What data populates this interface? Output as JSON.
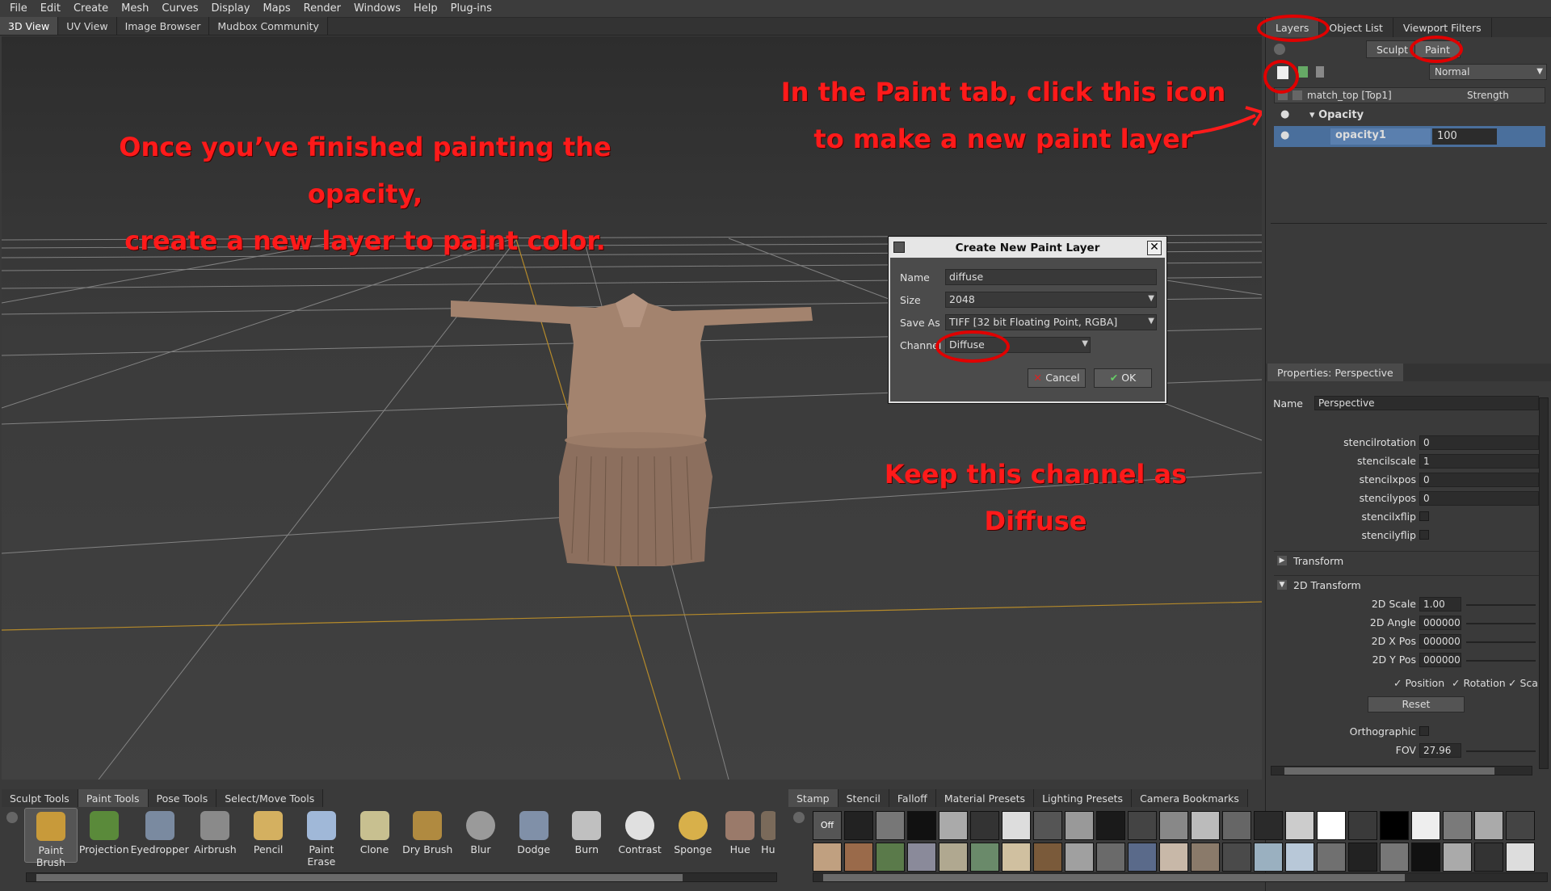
{
  "menu": [
    "File",
    "Edit",
    "Create",
    "Mesh",
    "Curves",
    "Display",
    "Maps",
    "Render",
    "Windows",
    "Help",
    "Plug-ins"
  ],
  "view_tabs": [
    "3D View",
    "UV View",
    "Image Browser",
    "Mudbox Community"
  ],
  "annotations": {
    "left": [
      "Once you’ve finished painting the opacity,",
      "create a new layer to paint color."
    ],
    "right": [
      "In the Paint tab, click this icon",
      "to make a new paint layer"
    ],
    "channel": "Keep this channel as Diffuse"
  },
  "dialog": {
    "title": "Create New Paint Layer",
    "name_label": "Name",
    "name_value": "diffuse",
    "size_label": "Size",
    "size_value": "2048",
    "saveas_label": "Save As",
    "saveas_value": "TIFF [32 bit Floating Point, RGBA]",
    "channel_label": "Channel",
    "channel_value": "Diffuse",
    "cancel": "Cancel",
    "ok": "OK"
  },
  "right_tabs": [
    "Layers",
    "Object List",
    "Viewport Filters"
  ],
  "layers": {
    "sculpt": "Sculpt",
    "paint": "Paint",
    "blend_mode": "Normal",
    "header_name": "match_top [Top1]",
    "header_strength": "Strength",
    "group": "Opacity",
    "layer_name": "opacity1",
    "layer_value": "100"
  },
  "properties": {
    "title": "Properties: Perspective",
    "name_label": "Name",
    "name_value": "Perspective",
    "rows": [
      {
        "label": "stencilrotation",
        "value": "0"
      },
      {
        "label": "stencilscale",
        "value": "1"
      },
      {
        "label": "stencilxpos",
        "value": "0"
      },
      {
        "label": "stencilypos",
        "value": "0"
      }
    ],
    "checks": [
      "stencilxflip",
      "stencilyflip"
    ],
    "transform": "Transform",
    "transform2d": "2D Transform",
    "t2d": [
      {
        "label": "2D Scale",
        "value": "1.00"
      },
      {
        "label": "2D Angle",
        "value": "000000"
      },
      {
        "label": "2D X Pos",
        "value": "000000"
      },
      {
        "label": "2D Y Pos",
        "value": "000000"
      }
    ],
    "position": "Position",
    "rotation": "Rotation",
    "scale": "Sca",
    "reset": "Reset",
    "orthographic": "Orthographic",
    "fov_label": "FOV",
    "fov_value": "27.96"
  },
  "bottom_left_tabs": [
    "Sculpt Tools",
    "Paint Tools",
    "Pose Tools",
    "Select/Move Tools"
  ],
  "paint_tools": [
    "Paint Brush",
    "Projection",
    "Eyedropper",
    "Airbrush",
    "Pencil",
    "Paint Erase",
    "Clone",
    "Dry Brush",
    "Blur",
    "Dodge",
    "Burn",
    "Contrast",
    "Sponge",
    "Hue",
    "Hu"
  ],
  "bottom_right_tabs": [
    "Stamp",
    "Stencil",
    "Falloff",
    "Material Presets",
    "Lighting Presets",
    "Camera Bookmarks"
  ],
  "stamp_off": "Off"
}
